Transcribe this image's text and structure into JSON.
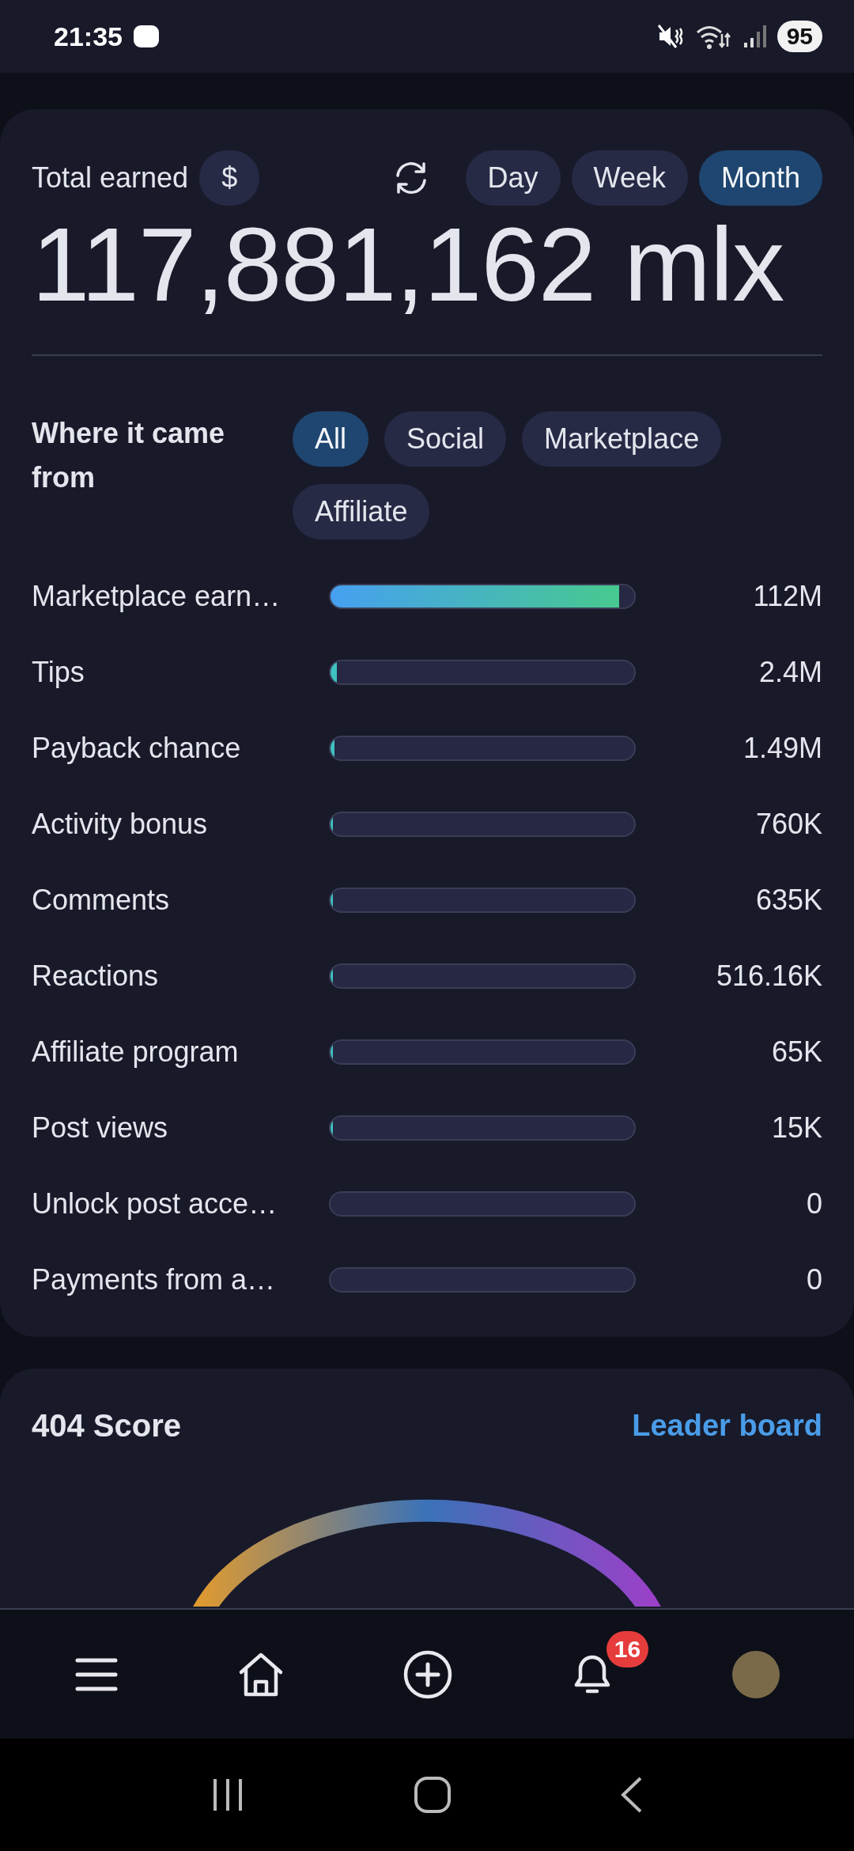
{
  "status_bar": {
    "time": "21:35",
    "battery": "95"
  },
  "earnings": {
    "title": "Total earned",
    "currency": "$",
    "periods": [
      {
        "label": "Day",
        "selected": false
      },
      {
        "label": "Week",
        "selected": false
      },
      {
        "label": "Month",
        "selected": true
      }
    ],
    "total": "117,881,162 mlx",
    "filter_label": "Where it came from",
    "filters": [
      {
        "label": "All",
        "selected": true
      },
      {
        "label": "Social",
        "selected": false
      },
      {
        "label": "Marketplace",
        "selected": false
      },
      {
        "label": "Affiliate",
        "selected": false
      }
    ],
    "rows": [
      {
        "name": "Marketplace earn…",
        "level": 0.95,
        "value": "112M"
      },
      {
        "name": "Tips",
        "level": 0.02,
        "value": "2.4M"
      },
      {
        "name": "Payback chance",
        "level": 0.013,
        "value": "1.49M"
      },
      {
        "name": "Activity bonus",
        "level": 0.007,
        "value": "760K"
      },
      {
        "name": "Comments",
        "level": 0.006,
        "value": "635K"
      },
      {
        "name": "Reactions",
        "level": 0.005,
        "value": "516.16K"
      },
      {
        "name": "Affiliate program",
        "level": 0.0006,
        "value": "65K"
      },
      {
        "name": "Post views",
        "level": 0.0001,
        "value": "15K"
      },
      {
        "name": "Unlock post acce…",
        "level": 0,
        "value": "0"
      },
      {
        "name": "Payments from a…",
        "level": 0,
        "value": "0"
      }
    ]
  },
  "score": {
    "title": "404 Score",
    "link": "Leader board"
  },
  "bottom_nav": {
    "notifications_badge": "16"
  }
}
